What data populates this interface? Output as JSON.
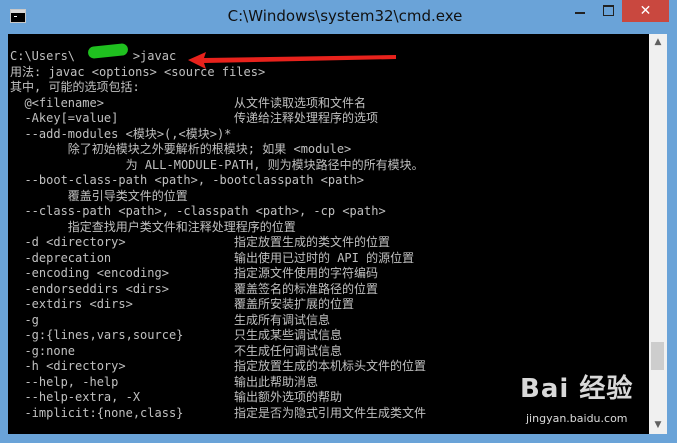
{
  "window": {
    "title": "C:\\Windows\\system32\\cmd.exe",
    "close_glyph": "✕"
  },
  "console": {
    "lines": [
      "C:\\Users\\        >javac",
      "用法: javac <options> <source files>",
      "其中, 可能的选项包括:",
      "  @<filename>                  从文件读取选项和文件名",
      "  -Akey[=value]                传递给注释处理程序的选项",
      "  --add-modules <模块>(,<模块>)*",
      "        除了初始模块之外要解析的根模块; 如果 <module>",
      "                为 ALL-MODULE-PATH, 则为模块路径中的所有模块。",
      "  --boot-class-path <path>, -bootclasspath <path>",
      "        覆盖引导类文件的位置",
      "  --class-path <path>, -classpath <path>, -cp <path>",
      "        指定查找用户类文件和注释处理程序的位置",
      "  -d <directory>               指定放置生成的类文件的位置",
      "  -deprecation                 输出使用已过时的 API 的源位置",
      "  -encoding <encoding>         指定源文件使用的字符编码",
      "  -endorseddirs <dirs>         覆盖签名的标准路径的位置",
      "  -extdirs <dirs>              覆盖所安装扩展的位置",
      "  -g                           生成所有调试信息",
      "  -g:{lines,vars,source}       只生成某些调试信息",
      "  -g:none                      不生成任何调试信息",
      "  -h <directory>               指定放置生成的本机标头文件的位置",
      "  --help, -help                输出此帮助消息",
      "  --help-extra, -X             输出额外选项的帮助",
      "  -implicit:{none,class}       指定是否为隐式引用文件生成类文件"
    ]
  },
  "scrollbar": {
    "up_glyph": "▲",
    "down_glyph": "▼"
  },
  "watermark": {
    "logo_text": "Bai 经验",
    "url": "jingyan.baidu.com"
  },
  "colors": {
    "title_bar": "#6aa3d8",
    "console_bg": "#000000",
    "console_text": "#c0c0c0",
    "close_button": "#c9483f",
    "annotation_arrow": "#e8221c",
    "redaction": "#1fc01f"
  }
}
